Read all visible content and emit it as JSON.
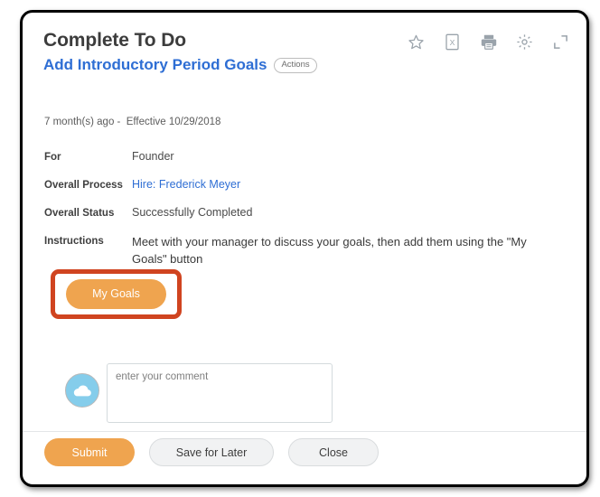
{
  "header": {
    "title": "Complete To Do",
    "subtitle_link": "Add Introductory Period Goals",
    "actions_badge": "Actions",
    "toolbar": [
      {
        "name": "favorite-star-icon",
        "label": "star-icon"
      },
      {
        "name": "export-excel-icon",
        "label": "excel-icon"
      },
      {
        "name": "print-icon",
        "label": "printer-icon"
      },
      {
        "name": "settings-gear-icon",
        "label": "gear-icon"
      },
      {
        "name": "expand-icon",
        "label": "expand-icon"
      }
    ]
  },
  "timestamp": "7 month(s) ago -  Effective 10/29/2018",
  "fields": [
    {
      "label": "For",
      "value": "Founder",
      "is_link": false
    },
    {
      "label": "Overall Process",
      "value": "Hire: Frederick Meyer",
      "is_link": true
    },
    {
      "label": "Overall Status",
      "value": "Successfully Completed",
      "is_link": false
    },
    {
      "label": "Instructions",
      "value": "Meet with your manager to discuss your goals, then add them using the \"My Goals\" button",
      "is_link": false
    }
  ],
  "action_button": {
    "label": "My Goals",
    "highlighted": true
  },
  "comment": {
    "placeholder": "enter your comment",
    "value": "",
    "avatar_icon": "cloud-icon"
  },
  "footer": {
    "submit_label": "Submit",
    "save_label": "Save for Later",
    "close_label": "Close"
  },
  "colors": {
    "accent_orange": "#efa44f",
    "link_blue": "#2e6ed4",
    "annotation_red": "#d04420",
    "avatar_blue": "#85cdeb",
    "frame_black": "#000000"
  }
}
